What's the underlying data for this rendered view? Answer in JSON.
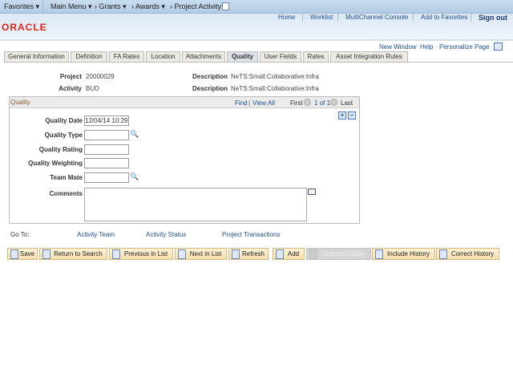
{
  "nav": {
    "favorites": "Favorites ▾",
    "main_menu": "Main Menu ▾",
    "crumbs": [
      "› Grants ▾",
      "› Awards ▾",
      "› Project Activity"
    ]
  },
  "header": {
    "links": [
      "Home",
      "Worklist",
      "MultiChannel Console",
      "Add to Favorites",
      "Sign out"
    ],
    "logo": "ORACLE"
  },
  "toolbar": {
    "new_window": "New Window",
    "help": "Help",
    "personalize": "Personalize Page"
  },
  "tabs": [
    {
      "label": "General Information"
    },
    {
      "label": "Definition"
    },
    {
      "label": "FA Rates"
    },
    {
      "label": "Location"
    },
    {
      "label": "Attachments"
    },
    {
      "label": "Quality",
      "active": true
    },
    {
      "label": "User Fields"
    },
    {
      "label": "Rates"
    },
    {
      "label": "Asset Integration Rules"
    }
  ],
  "keys": {
    "project_label": "Project",
    "project": "20000029",
    "activity_label": "Activity",
    "activity": "BUD",
    "desc_label": "Description",
    "project_desc": "NeTS:Small:Collaborative:Infra",
    "activity_desc": "NeTS:Small:Collaborative:Infra"
  },
  "quality": {
    "title": "Quality",
    "find": "Find",
    "view_all": "View All",
    "first": "First",
    "count": "1 of 1",
    "last": "Last",
    "fields": {
      "date_label": "Quality Date",
      "date": "12/04/14 10:29",
      "type_label": "Quality Type",
      "rating_label": "Quality Rating",
      "weighting_label": "Quality Weighting",
      "team_label": "Team Mate",
      "comments_label": "Comments"
    }
  },
  "goto": {
    "label": "Go To:",
    "links": [
      "Activity Team",
      "Activity Status",
      "Project Transactions"
    ]
  },
  "buttons": [
    "Save",
    "Return to Search",
    "Previous in List",
    "Next in List",
    "Refresh",
    "Add",
    "Update/Display",
    "Include History",
    "Correct History"
  ]
}
